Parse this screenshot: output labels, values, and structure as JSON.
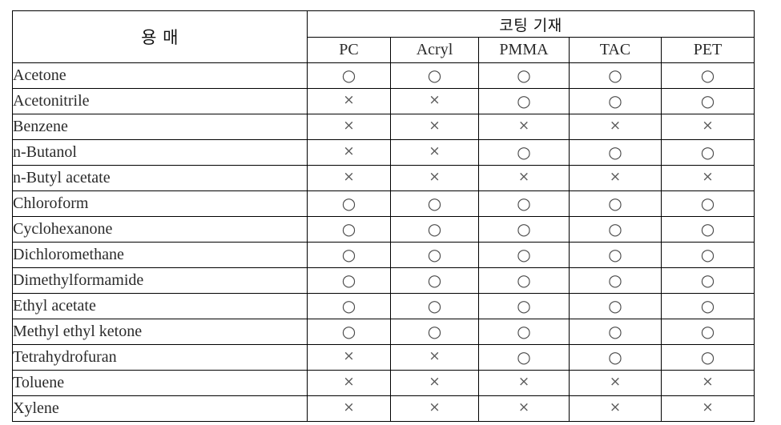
{
  "table": {
    "header": {
      "solvent_label": "용 매",
      "group_label": "코팅 기재",
      "substrate_columns": [
        "PC",
        "Acryl",
        "PMMA",
        "TAC",
        "PET"
      ]
    },
    "symbols": {
      "compatible": "○",
      "incompatible": "×"
    },
    "colors": {
      "border": "#000000",
      "text": "#2b2b2b",
      "mark": "#4a4a4a",
      "background": "#ffffff"
    },
    "rows": [
      {
        "solvent": "Acetone",
        "marks": [
          "○",
          "○",
          "○",
          "○",
          "○"
        ]
      },
      {
        "solvent": "Acetonitrile",
        "marks": [
          "×",
          "×",
          "○",
          "○",
          "○"
        ]
      },
      {
        "solvent": "Benzene",
        "marks": [
          "×",
          "×",
          "×",
          "×",
          "×"
        ]
      },
      {
        "solvent": "n-Butanol",
        "marks": [
          "×",
          "×",
          "○",
          "○",
          "○"
        ]
      },
      {
        "solvent": "n-Butyl acetate",
        "marks": [
          "×",
          "×",
          "×",
          "×",
          "×"
        ]
      },
      {
        "solvent": "Chloroform",
        "marks": [
          "○",
          "○",
          "○",
          "○",
          "○"
        ]
      },
      {
        "solvent": "Cyclohexanone",
        "marks": [
          "○",
          "○",
          "○",
          "○",
          "○"
        ]
      },
      {
        "solvent": "Dichloromethane",
        "marks": [
          "○",
          "○",
          "○",
          "○",
          "○"
        ]
      },
      {
        "solvent": "Dimethylformamide",
        "marks": [
          "○",
          "○",
          "○",
          "○",
          "○"
        ]
      },
      {
        "solvent": "Ethyl acetate",
        "marks": [
          "○",
          "○",
          "○",
          "○",
          "○"
        ]
      },
      {
        "solvent": "Methyl ethyl ketone",
        "marks": [
          "○",
          "○",
          "○",
          "○",
          "○"
        ]
      },
      {
        "solvent": "Tetrahydrofuran",
        "marks": [
          "×",
          "×",
          "○",
          "○",
          "○"
        ]
      },
      {
        "solvent": "Toluene",
        "marks": [
          "×",
          "×",
          "×",
          "×",
          "×"
        ]
      },
      {
        "solvent": "Xylene",
        "marks": [
          "×",
          "×",
          "×",
          "×",
          "×"
        ]
      }
    ]
  }
}
